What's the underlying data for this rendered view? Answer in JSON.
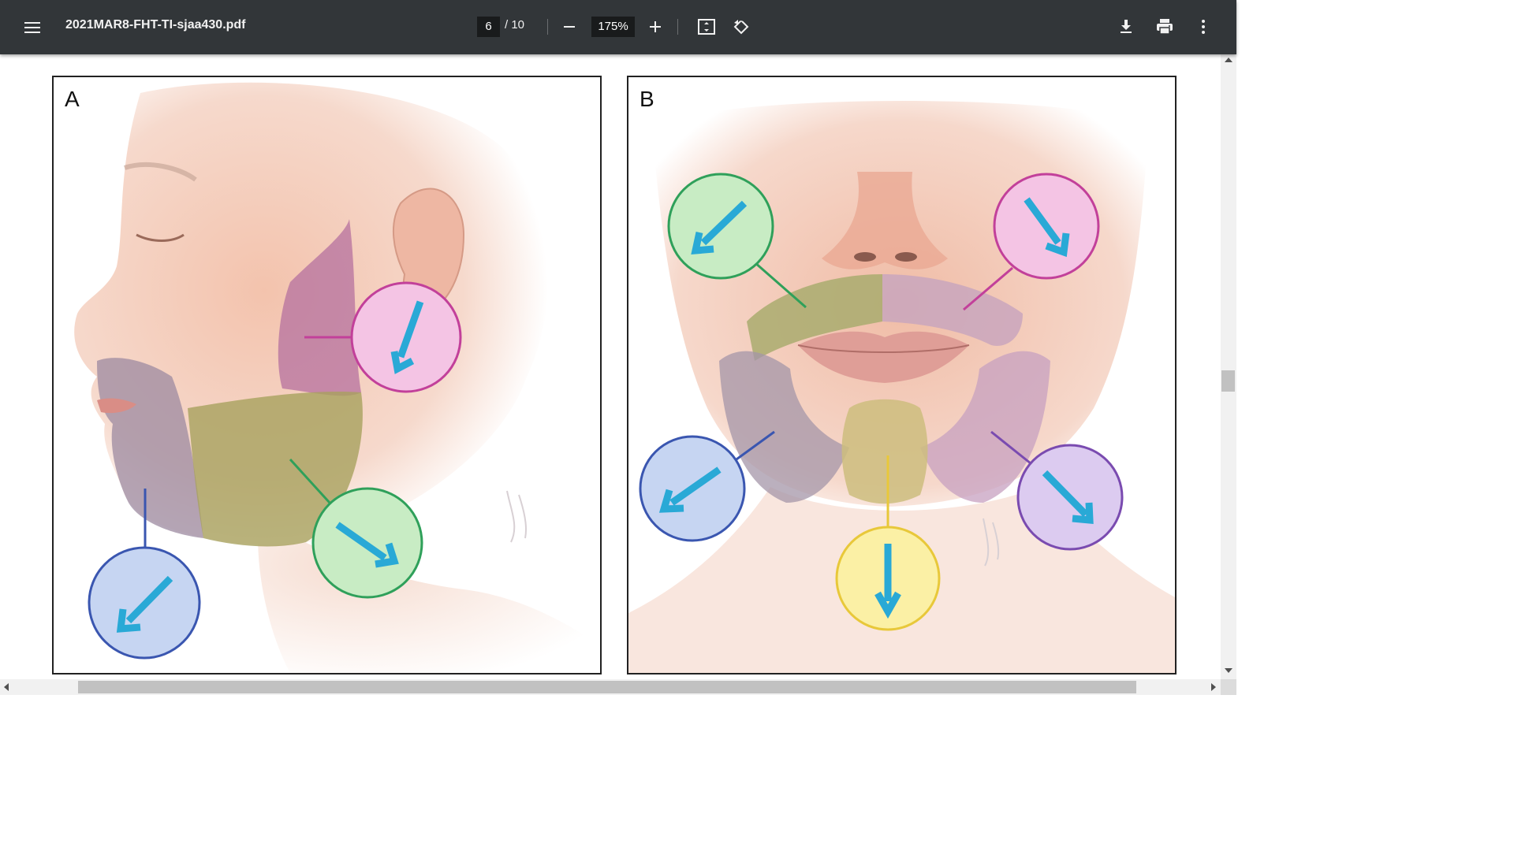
{
  "toolbar": {
    "file_name": "2021MAR8-FHT-TI-sjaa430.pdf",
    "page_current": "6",
    "page_total": "/ 10",
    "zoom": "175%",
    "icons": [
      "menu-icon",
      "zoom-out-icon",
      "zoom-in-icon",
      "fit-page-icon",
      "rotate-icon",
      "download-icon",
      "print-icon",
      "more-options-icon"
    ]
  },
  "figure": {
    "panel_a_label": "A",
    "panel_b_label": "B"
  },
  "colors": {
    "toolbar_bg": "#323639",
    "arrow": "#29a9d6",
    "pink": "#c2409a",
    "green": "#2fa05a",
    "blue": "#3a56b0",
    "yellow": "#e8c83a",
    "purple": "#7a4bb0"
  }
}
